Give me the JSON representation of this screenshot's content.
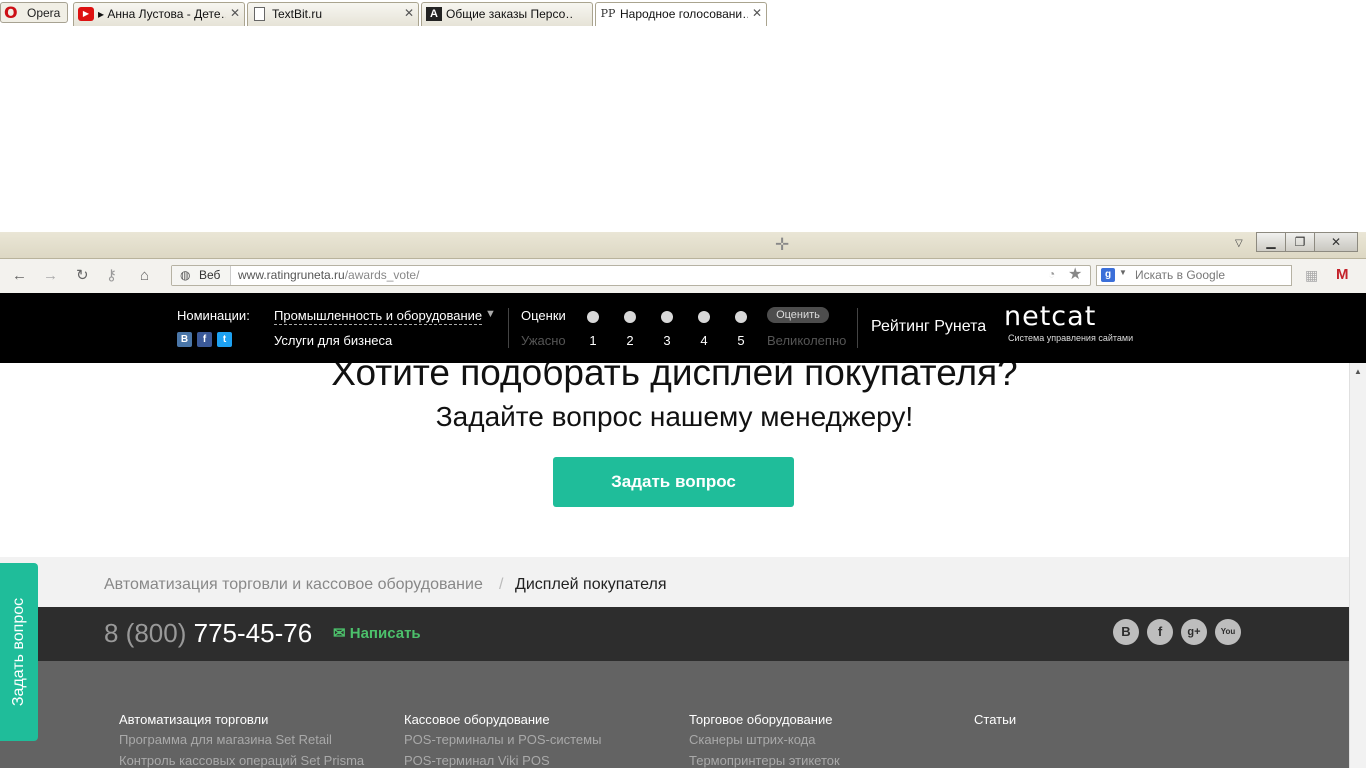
{
  "browser": {
    "opera_label": "Opera",
    "tabs": [
      {
        "title": "▸ Анна Лустова - Дете…",
        "icon": "▶"
      },
      {
        "title": "TextBit.ru",
        "icon": ""
      },
      {
        "title": "Общие заказы Персо…",
        "icon": "A"
      },
      {
        "title": "Народное голосовани…",
        "icon": "PP"
      }
    ],
    "web_label": "Веб",
    "url_domain": "www.ratingruneta.ru",
    "url_path": "/awards_vote/",
    "search_placeholder": "Искать в Google"
  },
  "rating_bar": {
    "nominations_label": "Номинации:",
    "nomination_selected": "Промышленность и оборудование",
    "nomination_sub": "Услуги для бизнеса",
    "social": [
      "B",
      "f",
      "t"
    ],
    "ratings_label": "Оценки",
    "low_label": "Ужасно",
    "scores": [
      "1",
      "2",
      "3",
      "4",
      "5"
    ],
    "rate_button": "Оценить",
    "high_label": "Великолепно",
    "title": "Рейтинг Рунета",
    "netcat_logo": "netcat",
    "netcat_tagline": "Система управления сайтами"
  },
  "main": {
    "headline": "Хотите подобрать дисплей покупателя?",
    "subheadline": "Задайте вопрос нашему менеджеру!",
    "ask_button": "Задать вопрос"
  },
  "breadcrumb": {
    "parent": "Автоматизация торговли и кассовое оборудование",
    "separator": "/",
    "current": "Дисплей покупателя"
  },
  "footer": {
    "phone_code": "8 (800)",
    "phone_number": "775-45-76",
    "write_label": "Написать",
    "social": [
      "B",
      "f",
      "g+",
      "You"
    ],
    "columns": [
      {
        "heading": "Автоматизация торговли",
        "links": [
          "Программа для магазина Set Retail",
          "Контроль кассовых операций Set Prisma"
        ]
      },
      {
        "heading": "Кассовое оборудование",
        "links": [
          "POS-терминалы и POS-системы",
          "POS-терминал Viki POS"
        ]
      },
      {
        "heading": "Торговое оборудование",
        "links": [
          "Сканеры штрих-кода",
          "Термопринтеры этикеток"
        ]
      },
      {
        "heading": "Статьи",
        "links": []
      }
    ]
  },
  "side_tab": "Задать вопрос",
  "colors": {
    "accent": "#1fbd9a",
    "bar": "#000000",
    "footer_dark": "#2d2d2d",
    "footer_gray": "#636363",
    "write_green": "#4cc06b"
  }
}
